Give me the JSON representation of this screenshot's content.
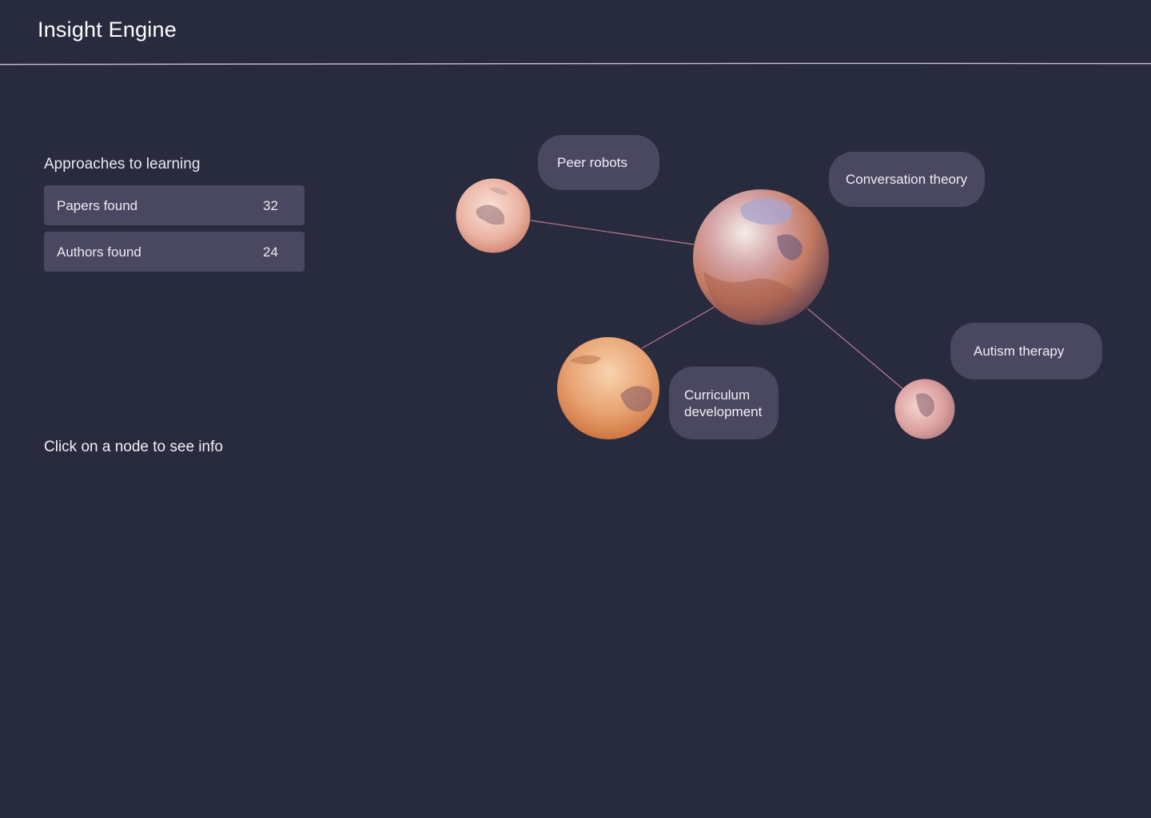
{
  "header": {
    "title": "Insight Engine"
  },
  "sidebar": {
    "section_title": "Approaches to learning",
    "stats": [
      {
        "label": "Papers found",
        "value": "32"
      },
      {
        "label": "Authors found",
        "value": "24"
      }
    ],
    "hint": "Click on a node to see info"
  },
  "graph": {
    "edge_color": "#b77a8f",
    "labels": {
      "peer_robots": "Peer robots",
      "conversation_theory": "Conversation theory",
      "autism_therapy": "Autism therapy",
      "curriculum_line1": "Curriculum",
      "curriculum_line2": "development"
    }
  }
}
